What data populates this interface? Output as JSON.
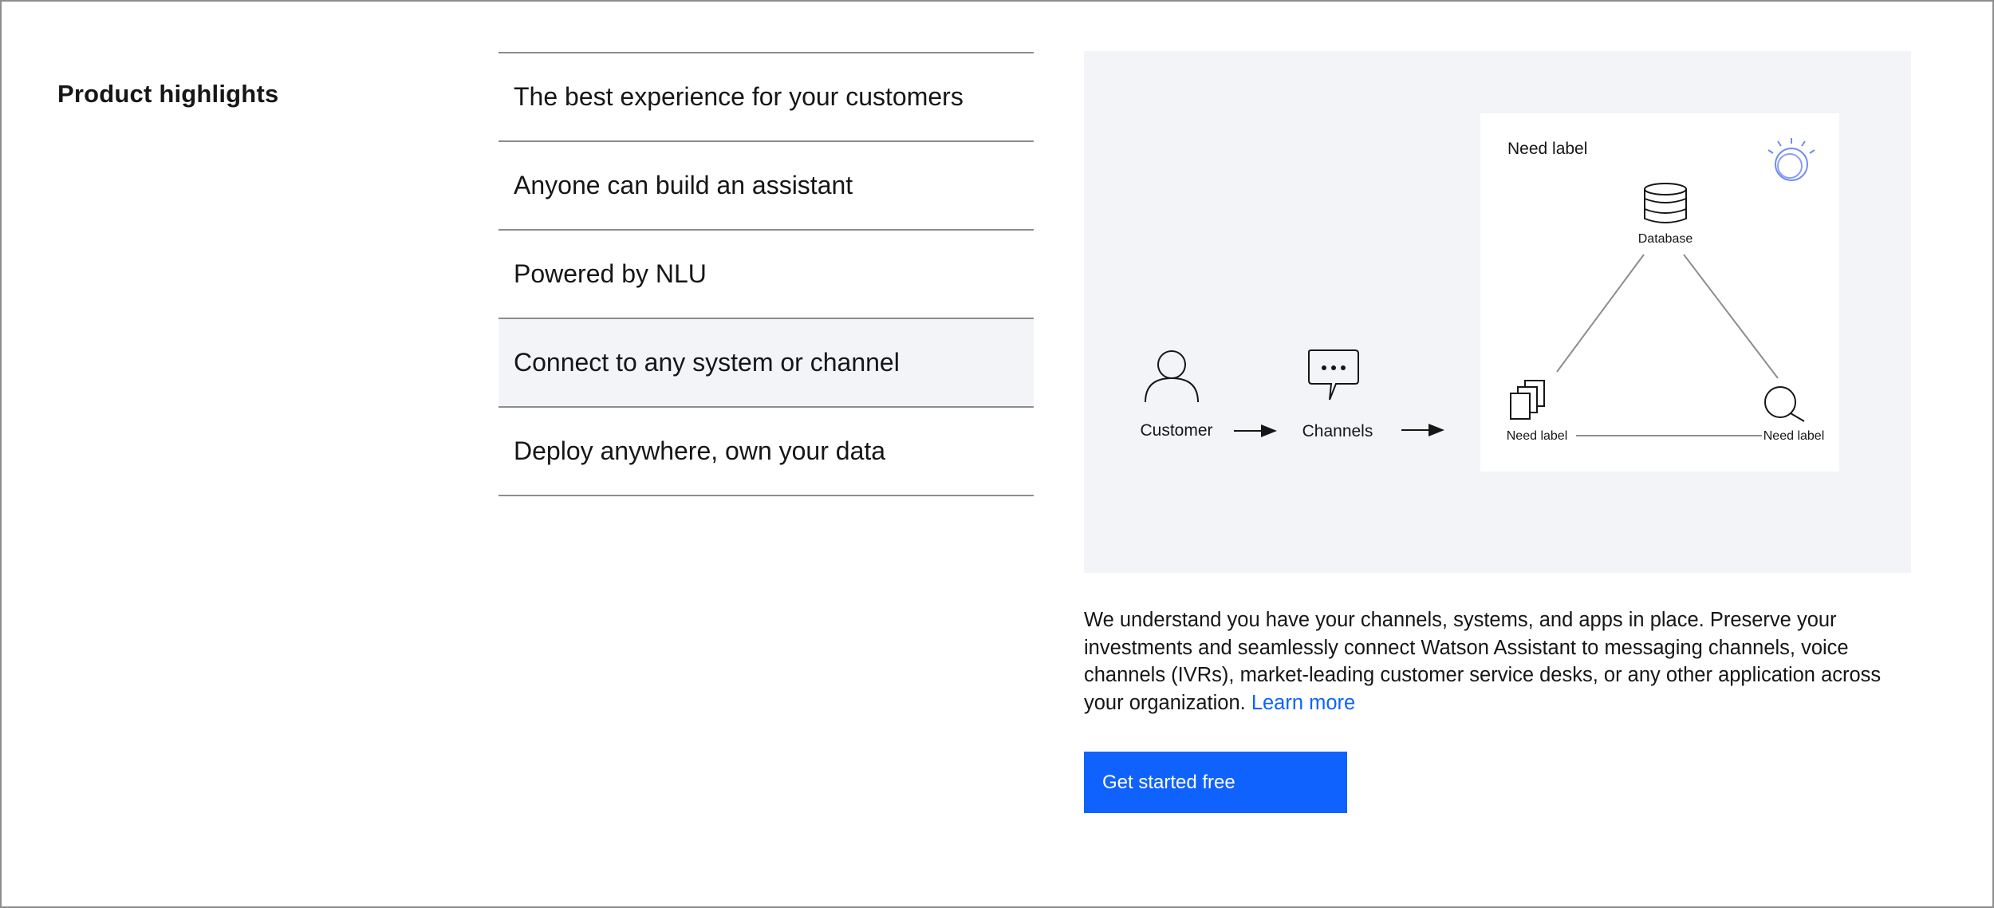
{
  "section": {
    "heading": "Product highlights"
  },
  "highlights": [
    {
      "label": "The best experience for your customers",
      "active": false
    },
    {
      "label": "Anyone can build an assistant",
      "active": false
    },
    {
      "label": "Powered by NLU",
      "active": false
    },
    {
      "label": "Connect to any system or channel",
      "active": true
    },
    {
      "label": "Deploy anywhere, own your data",
      "active": false
    }
  ],
  "diagram": {
    "customer_label": "Customer",
    "channels_label": "Channels",
    "card_title": "Need label",
    "database_label": "Database",
    "left_node_label": "Need label",
    "right_node_label": "Need label",
    "icons": [
      "user-icon",
      "chat-bubble-icon",
      "watson-logo-icon",
      "database-icon",
      "documents-icon",
      "search-icon",
      "arrow-right-icon"
    ]
  },
  "description": {
    "text": "We understand you have your channels, systems, and apps in place. Preserve your investments and seamlessly connect Watson Assistant to messaging channels, voice channels (IVRs), market-leading customer service desks, or any other application across your organization.",
    "link_label": "Learn more"
  },
  "cta": {
    "label": "Get started free"
  },
  "colors": {
    "accent": "#0f62fe",
    "panel_bg": "#f2f4f8",
    "divider": "#8d8d8d",
    "text": "#161616"
  }
}
